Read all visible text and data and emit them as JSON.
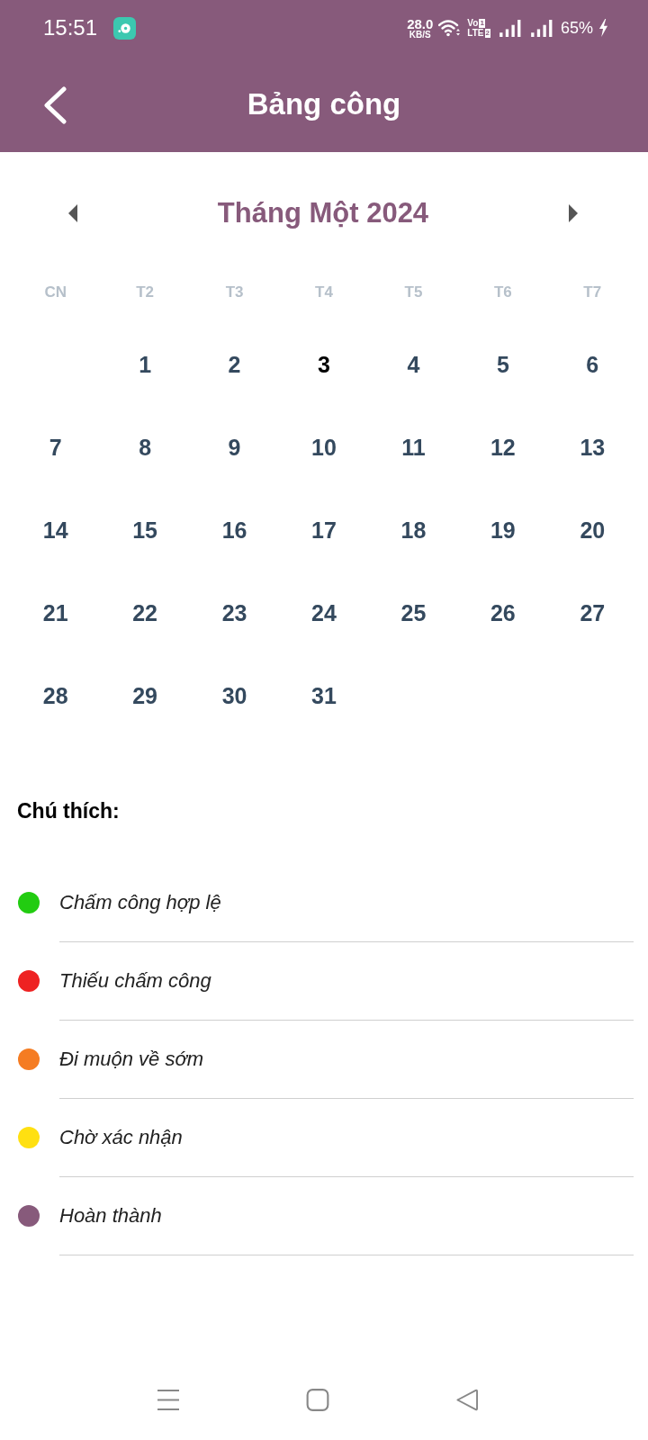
{
  "status_bar": {
    "time": "15:51",
    "speed": "28.0",
    "speed_unit": "KB/S",
    "volte": {
      "line_1": "Vo",
      "sim_1": "1",
      "line_2": "LTE",
      "sim_2": "2"
    },
    "battery": "65%",
    "charging": true
  },
  "app_bar": {
    "title": "Bảng công"
  },
  "calendar": {
    "month": "Tháng Một 2024",
    "weekdays": [
      "CN",
      "T2",
      "T3",
      "T4",
      "T5",
      "T6",
      "T7"
    ],
    "weeks": [
      {
        "days": [
          {
            "day": "1",
            "today": false
          },
          {
            "day": "2",
            "today": false
          },
          {
            "day": "3",
            "today": true
          },
          {
            "day": "4",
            "today": false
          },
          {
            "day": "5",
            "today": false
          },
          {
            "day": "6",
            "today": false
          }
        ]
      },
      {
        "days": [
          {
            "day": "7",
            "today": false
          },
          {
            "day": "8",
            "today": false
          },
          {
            "day": "9",
            "today": false
          },
          {
            "day": "10",
            "today": false
          },
          {
            "day": "11",
            "today": false
          },
          {
            "day": "12",
            "today": false
          },
          {
            "day": "13",
            "today": false
          }
        ]
      },
      {
        "days": [
          {
            "day": "14",
            "today": false
          },
          {
            "day": "15",
            "today": false
          },
          {
            "day": "16",
            "today": false
          },
          {
            "day": "17",
            "today": false
          },
          {
            "day": "18",
            "today": false
          },
          {
            "day": "19",
            "today": false
          },
          {
            "day": "20",
            "today": false
          }
        ]
      },
      {
        "days": [
          {
            "day": "21",
            "today": false
          },
          {
            "day": "22",
            "today": false
          },
          {
            "day": "23",
            "today": false
          },
          {
            "day": "24",
            "today": false
          },
          {
            "day": "25",
            "today": false
          },
          {
            "day": "26",
            "today": false
          },
          {
            "day": "27",
            "today": false
          }
        ]
      },
      {
        "days": [
          {
            "day": "28",
            "today": false
          },
          {
            "day": "29",
            "today": false
          },
          {
            "day": "30",
            "today": false
          },
          {
            "day": "31",
            "today": false
          }
        ]
      }
    ]
  },
  "legend": {
    "title": "Chú thích:",
    "items": [
      {
        "label": "Chấm công hợp lệ",
        "color": "#22cc11"
      },
      {
        "label": "Thiếu chấm công",
        "color": "#ee2222"
      },
      {
        "label": "Đi muộn về sớm",
        "color": "#f57c22"
      },
      {
        "label": "Chờ xác nhận",
        "color": "#ffe011"
      },
      {
        "label": "Hoàn thành",
        "color": "#875a7b"
      }
    ]
  }
}
